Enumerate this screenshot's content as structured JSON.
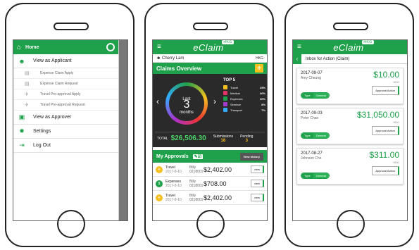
{
  "brand": {
    "logo": "eClaim",
    "badge": "HKG"
  },
  "colors": {
    "primary": "#1fa04a",
    "accent": "#f5c020",
    "dark": "#2a2a2a"
  },
  "phone1": {
    "home_label": "Home",
    "app_icon": "eClaim",
    "view_applicant": "View as Applicant",
    "sub_items": [
      {
        "label": "Expense Claim Apply",
        "icon": "receipt-icon"
      },
      {
        "label": "Expense Claim Request",
        "icon": "receipt-icon"
      },
      {
        "label": "Travel Pre-approval Apply",
        "icon": "plane-icon"
      },
      {
        "label": "Travel Pre-approval Request",
        "icon": "plane-icon"
      }
    ],
    "view_approver": "View as Approver",
    "settings": "Settings",
    "logout": "Log Out"
  },
  "phone2": {
    "user": "Cherry Lam",
    "region": "HKG",
    "overview_title": "Claims Overview",
    "ring_top": "Last",
    "ring_num": "3",
    "ring_bottom": "months",
    "top5_title": "TOP 5",
    "top5": [
      {
        "label": "Travel",
        "pct": "25%",
        "color": "#f5c020"
      },
      {
        "label": "Medical",
        "pct": "30%",
        "color": "#e33366"
      },
      {
        "label": "Expenses",
        "pct": "30%",
        "color": "#1fa04a"
      },
      {
        "label": "Seminar",
        "pct": "8%",
        "color": "#a33ccc"
      },
      {
        "label": "Transport",
        "pct": "7%",
        "color": "#33aaff"
      }
    ],
    "total_label": "TOTAL",
    "total_amount": "$26,506.30",
    "submissions_label": "Submissions",
    "submissions": "18",
    "pending_label": "Pending",
    "pending": "3",
    "approvals_title": "My Approvals",
    "view_history": "View history",
    "approvals": [
      {
        "cat": "Travel",
        "date": "2017-8-10",
        "name": "Billy",
        "id": "0218001",
        "amount": "$2,402.00",
        "color": "#f5c020",
        "btn": "view"
      },
      {
        "cat": "Expenses",
        "date": "2017-8-10",
        "name": "Billy",
        "id": "0218001",
        "amount": "$708.00",
        "color": "#1fa04a",
        "btn": "view"
      },
      {
        "cat": "Travel",
        "date": "2017-8-10",
        "name": "Billy",
        "id": "0218001",
        "amount": "$2,402.00",
        "color": "#f5c020",
        "btn": "view"
      }
    ]
  },
  "phone3": {
    "title": "Inbox for Action (Claim)",
    "cards": [
      {
        "date": "2017-09-07",
        "name": "Amy Cheung",
        "amount": "$10.00",
        "cur": "HKD",
        "type_label": "Type",
        "type": "General",
        "btn": "Approval Action"
      },
      {
        "date": "2017-09-03",
        "name": "Peter Chan",
        "amount": "$31,050.00",
        "cur": "HKD",
        "type_label": "Type",
        "type": "General",
        "btn": "Approval Action"
      },
      {
        "date": "2017-08-27",
        "name": "Johnson Cho",
        "amount": "$311.00",
        "cur": "HKD",
        "type_label": "Type",
        "type": "General",
        "btn": "Approval Action"
      }
    ]
  }
}
